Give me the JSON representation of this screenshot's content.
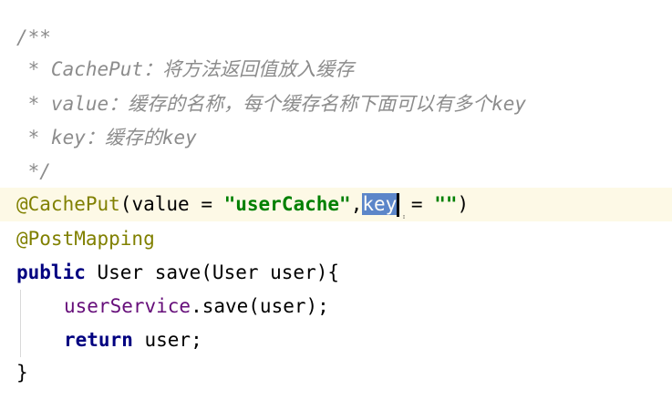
{
  "editor": {
    "comment": {
      "open": "/**",
      "line1": " * CachePut：将方法返回值放入缓存",
      "line2": " * value：缓存的名称，每个缓存名称下面可以有多个key",
      "line3": " * key：缓存的key",
      "close": " */"
    },
    "annotation_cacheput": {
      "name": "@CachePut",
      "open_paren": "(",
      "value_param": "value",
      "equals1": " = ",
      "value_string": "\"userCache\"",
      "comma": ",",
      "key_param": "key",
      "equals2": " = ",
      "key_string": "\"\"",
      "close_paren": ")"
    },
    "annotation_postmapping": "@PostMapping",
    "method_signature": {
      "keyword": "public",
      "rest": " User save(User user){"
    },
    "body_line1": {
      "field": "userService",
      "rest": ".save(user);"
    },
    "body_line2": {
      "keyword": "return",
      "rest": " user;"
    },
    "closing_brace": "}"
  }
}
